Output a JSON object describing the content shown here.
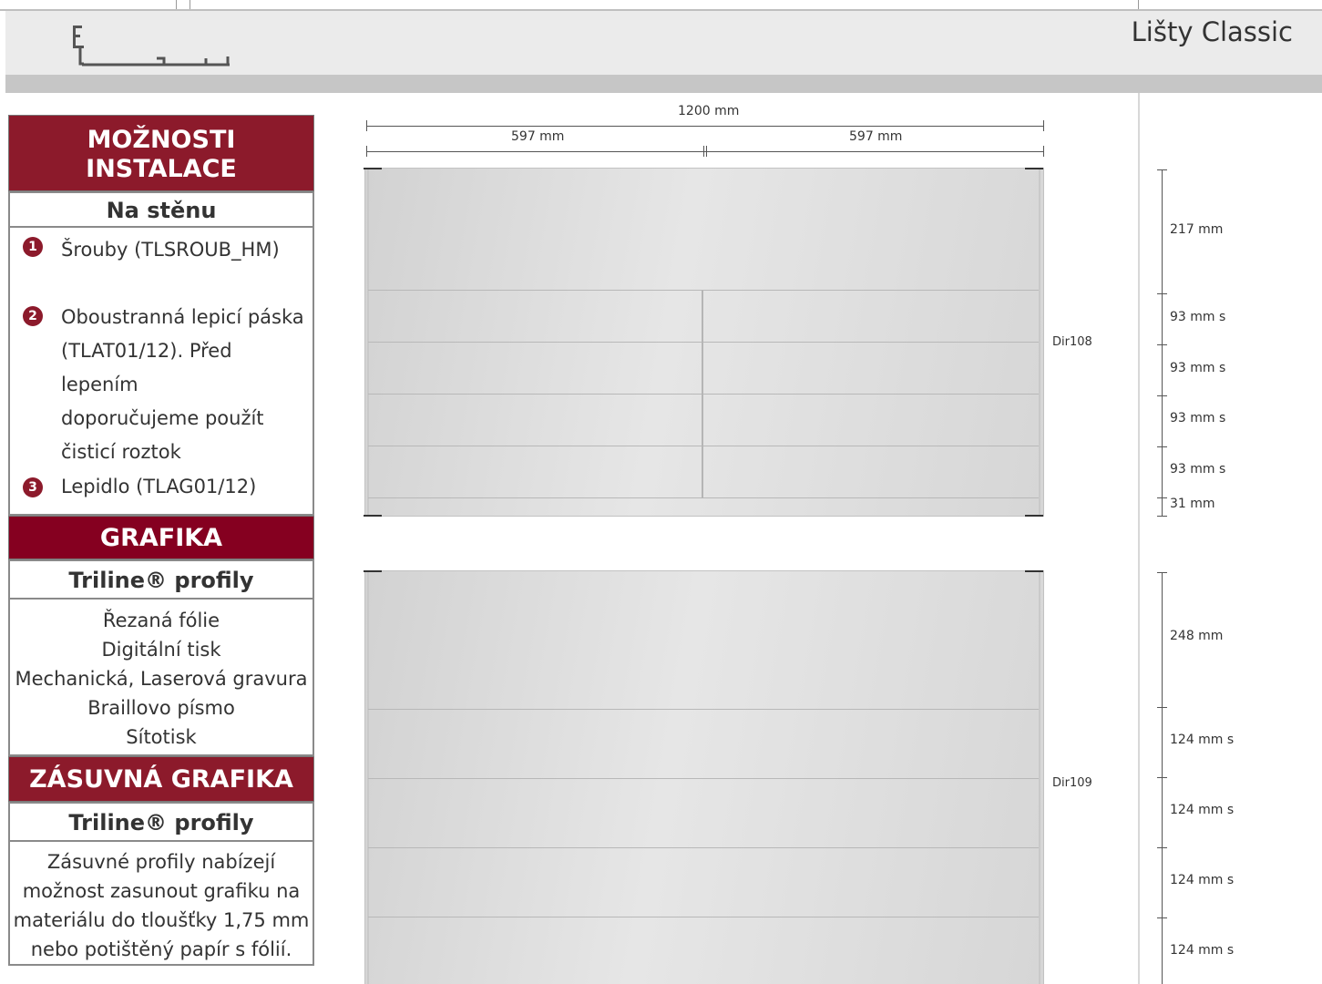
{
  "header": {
    "title": "Lišty Classic"
  },
  "install": {
    "heading": "MOŽNOSTI INSTALACE",
    "subheading": "Na stěnu",
    "items": [
      {
        "num": "1",
        "text": "Šrouby (TLSROUB_HM)"
      },
      {
        "num": "2",
        "lines": [
          "Oboustranná lepicí páska",
          "(TLAT01/12). Před lepením",
          "doporučujeme použít",
          "čisticí roztok"
        ]
      },
      {
        "num": "3",
        "text": "Lepidlo (TLAG01/12)"
      }
    ]
  },
  "graphics": {
    "heading": "GRAFIKA",
    "subheading": "Triline® profily",
    "items": [
      "Řezaná fólie",
      "Digitální tisk",
      "Mechanická, Laserová gravura",
      "Braillovo písmo",
      "Sítotisk"
    ]
  },
  "slide": {
    "heading": "ZÁSUVNÁ GRAFIKA",
    "subheading": "Triline® profily",
    "lines": [
      "Zásuvné profily nabízejí",
      "možnost zasunout grafiku na",
      "materiálu do tloušťky 1,75 mm",
      "nebo potištěný papír s fólií."
    ]
  },
  "drawing1": {
    "total": "1200 mm",
    "left_width": "597 mm",
    "right_width": "597 mm",
    "code": "Dir108",
    "dims": [
      "217 mm",
      "93 mm s",
      "93 mm s",
      "93 mm s",
      "93 mm s",
      "31 mm"
    ]
  },
  "drawing2": {
    "code": "Dir109",
    "dims": [
      "248 mm",
      "124 mm s",
      "124 mm s",
      "124 mm s",
      "124 mm s"
    ]
  }
}
